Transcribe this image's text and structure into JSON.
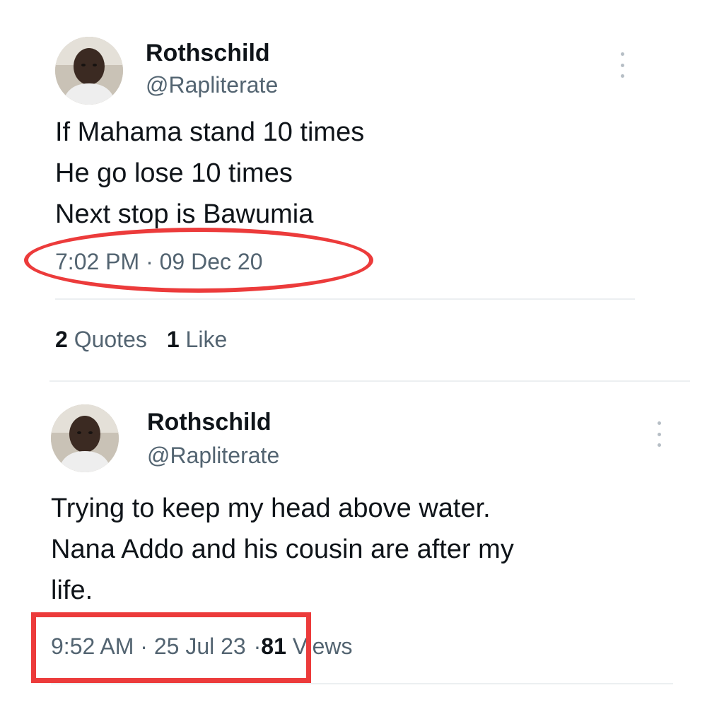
{
  "tweets": [
    {
      "author": {
        "name": "Rothschild",
        "handle": "@Rapliterate"
      },
      "text_lines": [
        "If Mahama stand 10 times",
        "He go lose 10 times",
        "Next stop is Bawumia"
      ],
      "timestamp": "7:02 PM · 09 Dec 20",
      "stats": {
        "quotes_count": "2",
        "quotes_label": "Quotes",
        "likes_count": "1",
        "likes_label": "Like"
      },
      "highlight": "ellipse"
    },
    {
      "author": {
        "name": "Rothschild",
        "handle": "@Rapliterate"
      },
      "text_lines": [
        "Trying to keep my head above water.",
        "Nana Addo and his cousin are after my",
        "life."
      ],
      "timestamp": "9:52 AM · 25 Jul 23",
      "views_separator": "·",
      "views_count": "81",
      "views_label": "Views",
      "highlight": "rectangle"
    }
  ],
  "colors": {
    "text_primary": "#0f1419",
    "text_secondary": "#536471",
    "annotation_red": "#ec3b3b",
    "divider": "#eceff1"
  },
  "icons": {
    "more_menu": "more-vertical-icon"
  }
}
